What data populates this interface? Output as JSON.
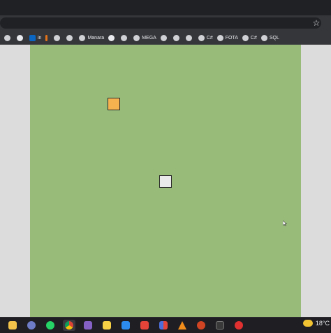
{
  "browser": {
    "bookmarks": [
      {
        "icon": "globe-icon",
        "label": ""
      },
      {
        "icon": "github-icon",
        "label": ""
      },
      {
        "icon": "linkedin-icon",
        "label": "in"
      },
      {
        "icon": "bookmark-icon",
        "label": ""
      },
      {
        "icon": "globe-icon",
        "label": ""
      },
      {
        "icon": "globe-icon",
        "label": ""
      },
      {
        "icon": "globe-icon",
        "label": "Manara"
      },
      {
        "icon": "github-icon",
        "label": ""
      },
      {
        "icon": "globe-icon",
        "label": ""
      },
      {
        "icon": "globe-icon",
        "label": "MEGA"
      },
      {
        "icon": "globe-icon",
        "label": ""
      },
      {
        "icon": "globe-icon",
        "label": ""
      },
      {
        "icon": "globe-icon",
        "label": ""
      },
      {
        "icon": "globe-icon",
        "label": "C#"
      },
      {
        "icon": "globe-icon",
        "label": "FOTA"
      },
      {
        "icon": "globe-icon",
        "label": "C#"
      },
      {
        "icon": "globe-icon",
        "label": "SQL"
      }
    ],
    "star_icon": "star-icon"
  },
  "game": {
    "background_color": "#98bb7a",
    "blocks": [
      {
        "name": "orange-block",
        "color": "#f5b24f"
      },
      {
        "name": "white-block",
        "color": "#eaeaea"
      }
    ]
  },
  "taskbar": {
    "apps": [
      {
        "name": "file-explorer-icon",
        "color": "#f3c34a"
      },
      {
        "name": "app-icon",
        "color": "#6e7cc8"
      },
      {
        "name": "whatsapp-icon",
        "color": "#25d366"
      },
      {
        "name": "chrome-icon",
        "color": "#e8eaed"
      },
      {
        "name": "visual-studio-icon",
        "color": "#8661c5"
      },
      {
        "name": "sticky-notes-icon",
        "color": "#f7d046"
      },
      {
        "name": "vscode-icon",
        "color": "#2d8cf0"
      },
      {
        "name": "app-red-icon",
        "color": "#e3443a"
      },
      {
        "name": "app-bluered-icon",
        "color": "#4c6ed9"
      },
      {
        "name": "vlc-icon",
        "color": "#f28c1b"
      },
      {
        "name": "powerpoint-icon",
        "color": "#d04423"
      },
      {
        "name": "terminal-icon",
        "color": "#3a3a3a"
      },
      {
        "name": "obs-icon",
        "color": "#e03030"
      }
    ],
    "weather": {
      "temperature": "18°C"
    }
  }
}
